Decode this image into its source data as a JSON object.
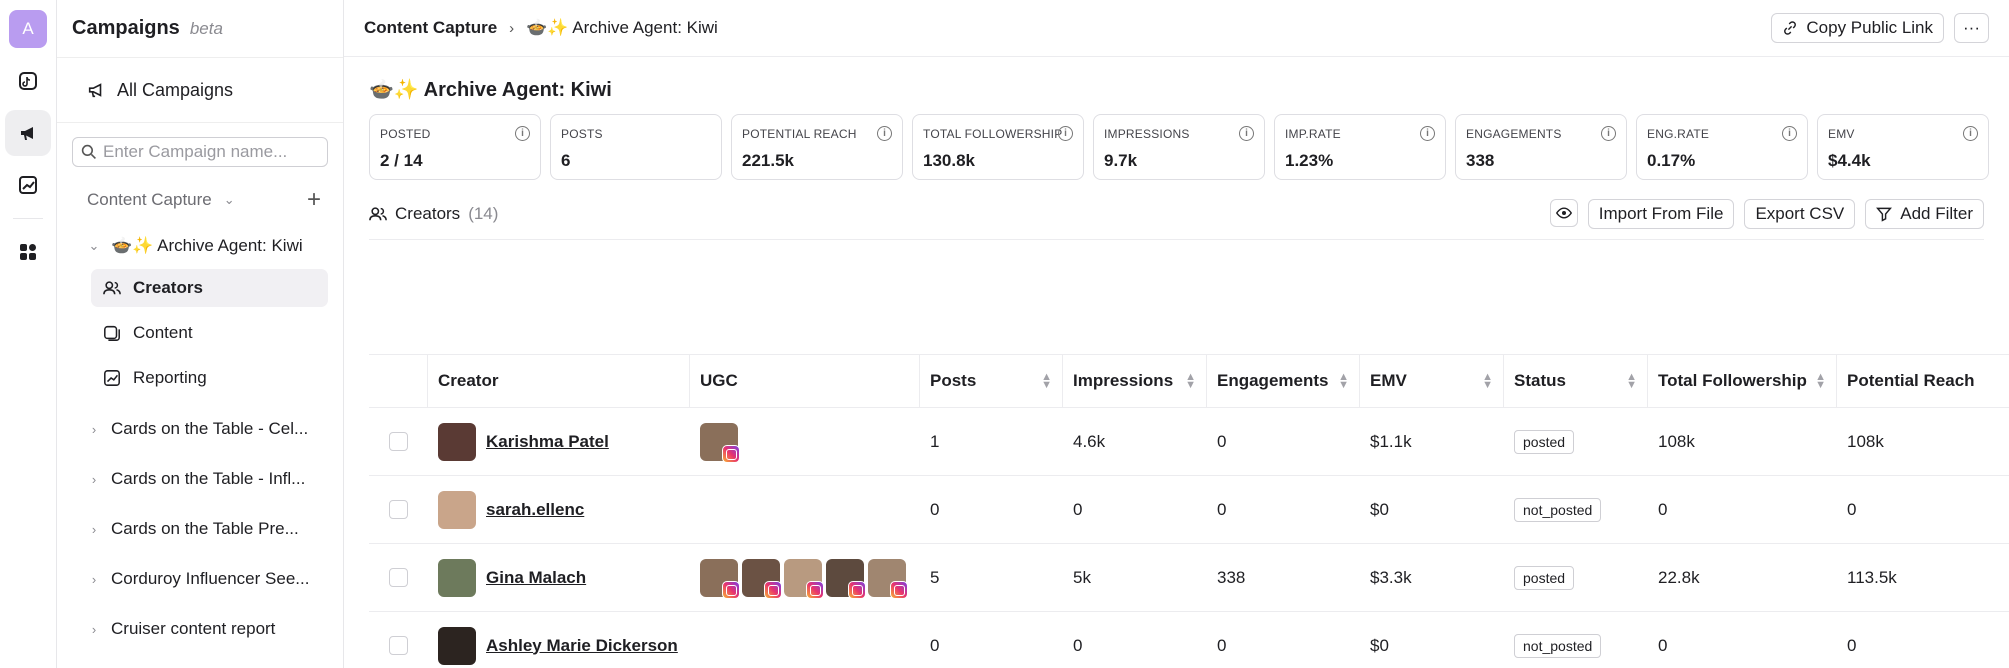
{
  "rail": {
    "avatar_letter": "A",
    "items": [
      "tiktok-icon",
      "megaphone-icon",
      "chart-icon",
      "apps-icon"
    ]
  },
  "sidebar": {
    "title": "Campaigns",
    "beta": "beta",
    "all_campaigns": "All Campaigns",
    "search_placeholder": "Enter Campaign name...",
    "group_label": "Content Capture",
    "active_campaign": "🍲✨ Archive Agent: Kiwi",
    "sub_items": [
      {
        "label": "Creators",
        "icon": "users-icon"
      },
      {
        "label": "Content",
        "icon": "content-icon"
      },
      {
        "label": "Reporting",
        "icon": "report-icon"
      }
    ],
    "campaigns": [
      "Cards on the Table - Cel...",
      "Cards on the Table - Infl...",
      "Cards on the Table Pre...",
      "Corduroy Influencer See...",
      "Cruiser content report"
    ]
  },
  "topbar": {
    "crumb1": "Content Capture",
    "crumb2": "🍲✨ Archive Agent: Kiwi",
    "copy_link": "Copy Public Link",
    "more": "···"
  },
  "page": {
    "title": "🍲✨ Archive Agent: Kiwi"
  },
  "stats": [
    {
      "label": "POSTED",
      "value": "2 / 14",
      "info": true
    },
    {
      "label": "POSTS",
      "value": "6",
      "info": false
    },
    {
      "label": "POTENTIAL REACH",
      "value": "221.5k",
      "info": true
    },
    {
      "label": "TOTAL FOLLOWERSHIP",
      "value": "130.8k",
      "info": true
    },
    {
      "label": "IMPRESSIONS",
      "value": "9.7k",
      "info": true
    },
    {
      "label": "IMP.RATE",
      "value": "1.23%",
      "info": true
    },
    {
      "label": "ENGAGEMENTS",
      "value": "338",
      "info": true
    },
    {
      "label": "ENG.RATE",
      "value": "0.17%",
      "info": true
    },
    {
      "label": "EMV",
      "value": "$4.4k",
      "info": true
    }
  ],
  "creators_bar": {
    "label": "Creators",
    "count": "(14)",
    "import": "Import From File",
    "export": "Export CSV",
    "filter": "Add Filter"
  },
  "table": {
    "headers": [
      "Creator",
      "UGC",
      "Posts",
      "Impressions",
      "Engagements",
      "EMV",
      "Status",
      "Total Followership",
      "Potential Reach"
    ],
    "rows": [
      {
        "name": "Karishma Patel",
        "ugc": 1,
        "posts": "1",
        "impressions": "4.6k",
        "engagements": "0",
        "emv": "$1.1k",
        "status": "posted",
        "followership": "108k",
        "reach": "108k",
        "pfp_color": "#5a3a34"
      },
      {
        "name": "sarah.ellenc",
        "ugc": 0,
        "posts": "0",
        "impressions": "0",
        "engagements": "0",
        "emv": "$0",
        "status": "not_posted",
        "followership": "0",
        "reach": "0",
        "pfp_color": "#c9a58a"
      },
      {
        "name": "Gina Malach",
        "ugc": 5,
        "posts": "5",
        "impressions": "5k",
        "engagements": "338",
        "emv": "$3.3k",
        "status": "posted",
        "followership": "22.8k",
        "reach": "113.5k",
        "pfp_color": "#6d7a5c"
      },
      {
        "name": "Ashley Marie Dickerson",
        "ugc": 0,
        "posts": "0",
        "impressions": "0",
        "engagements": "0",
        "emv": "$0",
        "status": "not_posted",
        "followership": "0",
        "reach": "0",
        "pfp_color": "#2c2420"
      }
    ]
  }
}
